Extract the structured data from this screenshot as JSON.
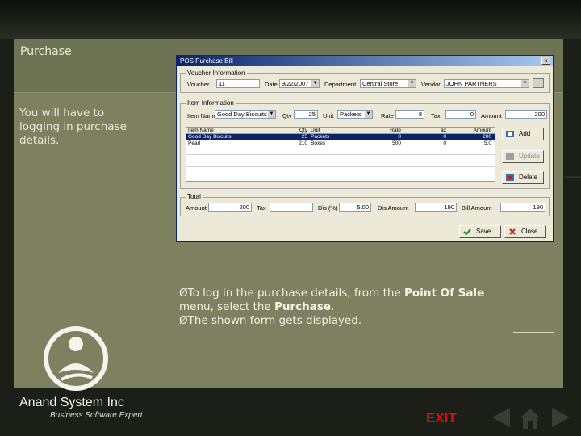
{
  "slide": {
    "title": "Purchase",
    "intro": "You will have to logging in purchase details.",
    "caption_prefix": "ØTo log in the purchase details, from the ",
    "caption_bold1": "Point Of Sale",
    "caption_mid": " menu, select the ",
    "caption_bold2": "Purchase",
    "caption_end": ".",
    "caption_line2": "ØThe shown form gets displayed."
  },
  "branding": {
    "company": "Anand System Inc",
    "tagline": "Business Software Expert",
    "exit_label": "EXIT"
  },
  "window": {
    "title": "POS Purchase Bill",
    "close": "×",
    "voucher_group": "Voucher Information",
    "voucher_label": "Voucher",
    "voucher_value": "11",
    "date_label": "Date",
    "date_value": "9/22/2007",
    "department_label": "Department",
    "department_value": "Central Store",
    "vendor_label": "Vendor",
    "vendor_value": "JOHN PARTNERS",
    "item_group": "Item Information",
    "item_name_label": "Item Name",
    "item_name_value": "Good Day Biscuits",
    "qty_label": "Qty",
    "qty_value": "25",
    "unit_label": "Unit",
    "unit_value": "Packets",
    "rate_label": "Rate",
    "rate_value": "8",
    "tax_label": "Tax",
    "tax_value": "0",
    "amount_label": "Amount",
    "amount_value": "200",
    "grid_headers": [
      "Item Name",
      "Qty",
      "Unit",
      "Rate",
      "ax",
      "Amount"
    ],
    "grid_rows": [
      [
        "Good Day Biscuits",
        "25",
        "Packets",
        "8",
        "0",
        "200"
      ],
      [
        "Pearl",
        "210",
        "Boxes",
        "500",
        "0",
        "5.0"
      ]
    ],
    "add_label": "Add",
    "update_label": "Update",
    "delete_label": "Delete",
    "total_group": "Total",
    "total_amount_label": "Amount",
    "total_amount_value": "200",
    "total_tax_label": "Tax",
    "dis_label": "Dis (%)",
    "dis_value": "5.00",
    "dis_amount_label": "Dis Amount",
    "dis_amount_value": "190",
    "bill_amount_label": "Bill Amount",
    "bill_amount_value": "190",
    "save_label": "Save",
    "close_label": "Close"
  },
  "colors": {
    "panel": "#7d8160",
    "titlebar": "#0a246a",
    "exit": "#e01010"
  }
}
